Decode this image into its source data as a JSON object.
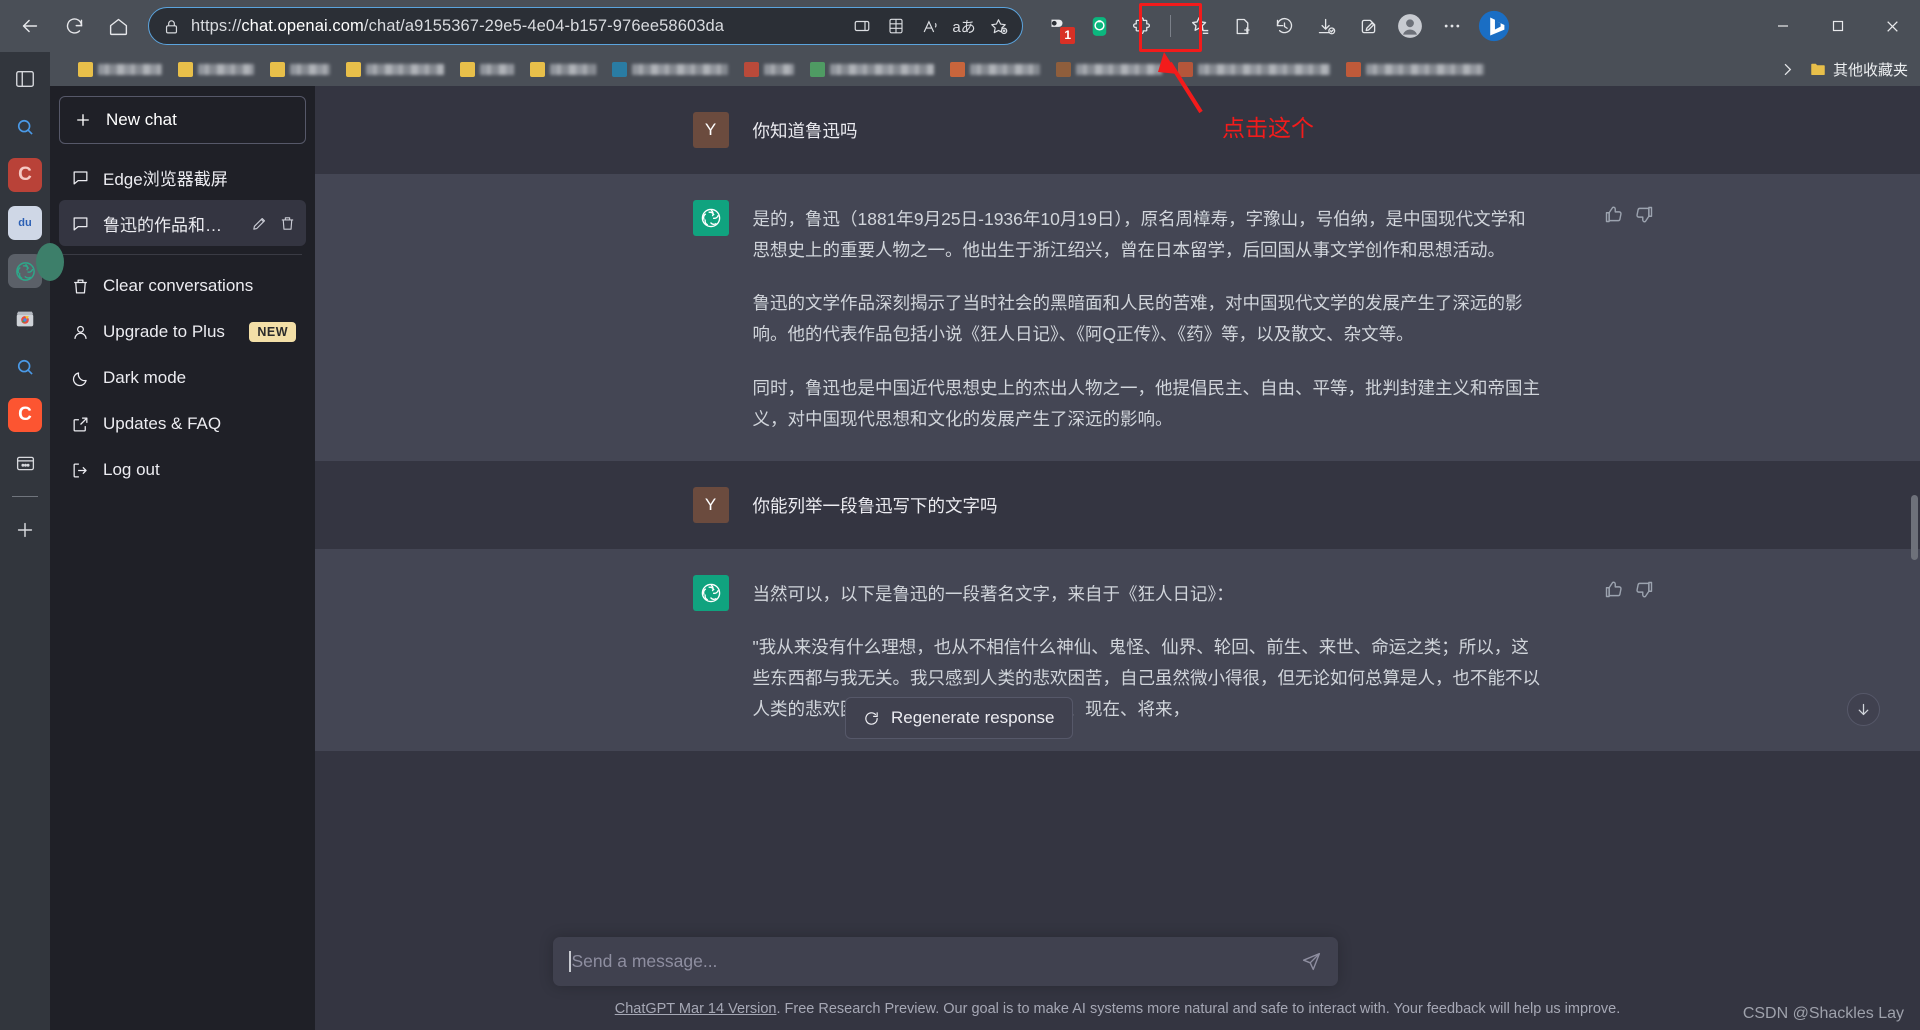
{
  "browser": {
    "url_prefix": "https://",
    "url_host": "chat.openai.com",
    "url_path": "/chat/a9155367-29e5-4e04-b157-976ee58603da",
    "back_icon": "back-arrow-icon",
    "reload_icon": "reload-icon",
    "home_icon": "home-icon",
    "lock_icon": "lock-icon",
    "split_screen_icon": "split-screen-icon",
    "grid_icon": "collections-grid-icon",
    "read_aloud_icon": "read-aloud-icon",
    "translate_icon": "translate-icon",
    "add_favorite_icon": "add-favorite-icon",
    "extension_badge_count": "1",
    "toolbar_icons": [
      "browser-essentials-icon",
      "screenshot-capture-icon",
      "extensions-puzzle-icon",
      "favorites-icon",
      "collections-icon",
      "history-icon",
      "downloads-icon",
      "edit-capture-icon",
      "profile-avatar-icon",
      "more-options-icon",
      "bing-copilot-icon"
    ],
    "window_minimize": "minimize-icon",
    "window_maximize": "maximize-icon",
    "window_close": "close-icon",
    "bookmarks_overflow": "chevron-right-icon",
    "bookmarks_folder_label": "其他收藏夹"
  },
  "rail": {
    "items": [
      {
        "name": "tab-actions-icon",
        "text": "",
        "color": "#d7d9dd"
      },
      {
        "name": "search-icon",
        "text": "",
        "color": "#4a9ae8"
      },
      {
        "name": "csdn-icon",
        "text": "C",
        "color": "#c0392b"
      },
      {
        "name": "baidu-icon",
        "text": "du",
        "color": "#2b5fb4"
      },
      {
        "name": "chatgpt-icon",
        "text": "",
        "color": "#10a37f"
      },
      {
        "name": "chrome-store-icon",
        "text": "",
        "color": "#d94f3d"
      },
      {
        "name": "search2-icon",
        "text": "",
        "color": "#4a9ae8"
      },
      {
        "name": "csdn2-icon",
        "text": "C",
        "color": "#fc5531"
      },
      {
        "name": "archive-icon",
        "text": "",
        "color": "#d7d9dd"
      },
      {
        "name": "add-tab-icon",
        "text": "",
        "color": "#d7d9dd"
      }
    ]
  },
  "sidebar": {
    "new_chat_label": "New chat",
    "new_chat_icon": "plus-icon",
    "conversations": [
      {
        "label": "Edge浏览器截屏",
        "icon": "chat-bubble-icon",
        "selected": false
      },
      {
        "label": "鲁迅的作品和思想",
        "icon": "chat-bubble-icon",
        "selected": true,
        "edit_icon": "pencil-icon",
        "delete_icon": "trash-icon"
      }
    ],
    "menu": [
      {
        "label": "Clear conversations",
        "icon": "trash-icon",
        "badge": ""
      },
      {
        "label": "Upgrade to Plus",
        "icon": "person-icon",
        "badge": "NEW"
      },
      {
        "label": "Dark mode",
        "icon": "moon-icon",
        "badge": ""
      },
      {
        "label": "Updates & FAQ",
        "icon": "external-link-icon",
        "badge": ""
      },
      {
        "label": "Log out",
        "icon": "logout-icon",
        "badge": ""
      }
    ]
  },
  "chat": {
    "user_avatar_letter": "Y",
    "messages": [
      {
        "role": "user",
        "paragraphs": [
          "你知道鲁迅吗"
        ]
      },
      {
        "role": "bot",
        "paragraphs": [
          "是的，鲁迅（1881年9月25日-1936年10月19日），原名周樟寿，字豫山，号伯纳，是中国现代文学和思想史上的重要人物之一。他出生于浙江绍兴，曾在日本留学，后回国从事文学创作和思想活动。",
          "鲁迅的文学作品深刻揭示了当时社会的黑暗面和人民的苦难，对中国现代文学的发展产生了深远的影响。他的代表作品包括小说《狂人日记》、《阿Q正传》、《药》等，以及散文、杂文等。",
          "同时，鲁迅也是中国近代思想史上的杰出人物之一，他提倡民主、自由、平等，批判封建主义和帝国主义，对中国现代思想和文化的发展产生了深远的影响。"
        ],
        "like_icon": "thumbs-up-icon",
        "dislike_icon": "thumbs-down-icon"
      },
      {
        "role": "user",
        "paragraphs": [
          "你能列举一段鲁迅写下的文字吗"
        ]
      },
      {
        "role": "bot",
        "paragraphs": [
          "当然可以，以下是鲁迅的一段著名文字，来自于《狂人日记》：",
          "\"我从来没有什么理想，也从不相信什么神仙、鬼怪、仙界、轮回、前生、来世、命运之类；所以，这些东西都与我无关。我只感到人类的悲欢困苦，自己虽然微小得很，但无论如何总算是人，也不能不以人类的悲欢困苦为悲欢困苦，不管是过去、现在、将来，"
        ],
        "like_icon": "thumbs-up-icon",
        "dislike_icon": "thumbs-down-icon"
      }
    ],
    "regenerate_label": "Regenerate response",
    "regenerate_icon": "refresh-icon",
    "scroll_down_icon": "arrow-down-icon"
  },
  "composer": {
    "placeholder": "Send a message...",
    "value": "",
    "send_icon": "send-icon"
  },
  "footer": {
    "link_text": "ChatGPT Mar 14 Version",
    "rest_text": ". Free Research Preview. Our goal is to make AI systems more natural and safe to interact with. Your feedback will help us improve."
  },
  "annotation": {
    "text": "点击这个",
    "color": "#f31b1b"
  },
  "watermark": "CSDN @Shackles Lay"
}
